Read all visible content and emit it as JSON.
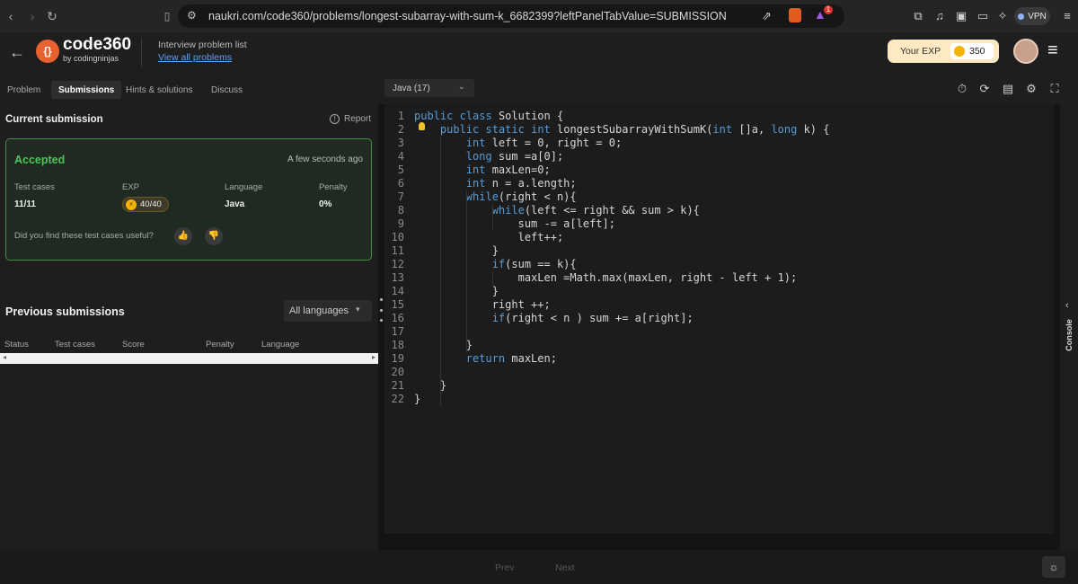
{
  "browser": {
    "url": "naukri.com/code360/problems/longest-subarray-with-sum-k_6682399?leftPanelTabValue=SUBMISSION",
    "vpn_label": "VPN",
    "notif_count": "1"
  },
  "header": {
    "brand": "code360",
    "brand_sub": "by codingninjas",
    "nav_title": "Interview problem list",
    "nav_link": "View all problems",
    "exp_label": "Your EXP",
    "exp_value": "350"
  },
  "tabs": [
    {
      "label": "Problem",
      "active": false
    },
    {
      "label": "Submissions",
      "active": true
    },
    {
      "label": "Hints & solutions",
      "active": false
    },
    {
      "label": "Discuss",
      "active": false
    }
  ],
  "current_submission": {
    "title": "Current submission",
    "report_label": "Report",
    "status": "Accepted",
    "time": "A few seconds ago",
    "headers": [
      "Test cases",
      "EXP",
      "Language",
      "Penalty"
    ],
    "test_cases": "11/11",
    "exp": "40/40",
    "language": "Java",
    "penalty": "0%",
    "feedback_question": "Did you find these test cases useful?"
  },
  "previous_submissions": {
    "title": "Previous submissions",
    "filter": "All languages",
    "columns": [
      "Status",
      "Test cases",
      "Score",
      "Penalty",
      "Language"
    ]
  },
  "editor": {
    "language": "Java (17)",
    "lines": [
      "public class Solution {",
      "    public static int longestSubarrayWithSumK(int []a, long k) {",
      "        int left = 0, right = 0;",
      "        long sum =a[0];",
      "        int maxLen=0;",
      "        int n = a.length;",
      "        while(right < n){",
      "            while(left <= right && sum > k){",
      "                sum -= a[left];",
      "                left++;",
      "            }",
      "            if(sum == k){",
      "                maxLen =Math.max(maxLen, right - left + 1);",
      "            }",
      "            right ++;",
      "            if(right < n ) sum += a[right];",
      "",
      "        }",
      "        return maxLen;",
      "",
      "    }",
      "}"
    ]
  },
  "console_label": "Console",
  "footer": {
    "prev": "Prev",
    "next": "Next"
  }
}
